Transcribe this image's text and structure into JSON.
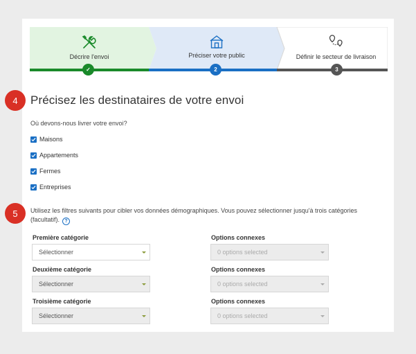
{
  "stepper": {
    "steps": [
      {
        "label": "Décrire l'envoi",
        "marker": "✓",
        "icon": "tools-icon",
        "state": "done"
      },
      {
        "label": "Préciser votre public",
        "marker": "2",
        "icon": "house-icon",
        "state": "active"
      },
      {
        "label": "Définir le secteur de livraison",
        "marker": "3",
        "icon": "route-pins-icon",
        "state": "upcoming"
      }
    ],
    "colors": {
      "done_bg": "#e2f4e1",
      "done_bar": "#1a8a2a",
      "active_bg": "#dfe9f7",
      "active_bar": "#1a6fc4",
      "upcoming_bar": "#555555"
    }
  },
  "badges": {
    "four": "4",
    "five": "5",
    "color": "#d93025"
  },
  "main": {
    "heading": "Précisez les destinataires de votre envoi",
    "question": "Où devons-nous livrer votre envoi?",
    "checkboxes": [
      {
        "label": "Maisons",
        "checked": true
      },
      {
        "label": "Appartements",
        "checked": true
      },
      {
        "label": "Fermes",
        "checked": true
      },
      {
        "label": "Entreprises",
        "checked": true
      }
    ],
    "filters_text": "Utilisez les filtres suivants pour cibler vos données démographiques. Vous pouvez sélectionner jusqu'à trois catégories (facultatif).",
    "help_icon": "?",
    "rows": [
      {
        "category_label": "Première catégorie",
        "category_value": "Sélectionner",
        "category_enabled": true,
        "options_label": "Options connexes",
        "options_value": "0 options selected"
      },
      {
        "category_label": "Deuxième catégorie",
        "category_value": "Sélectionner",
        "category_enabled": false,
        "options_label": "Options connexes",
        "options_value": "0 options selected"
      },
      {
        "category_label": "Troisième catégorie",
        "category_value": "Sélectionner",
        "category_enabled": false,
        "options_label": "Options connexes",
        "options_value": "0 options selected"
      }
    ]
  }
}
